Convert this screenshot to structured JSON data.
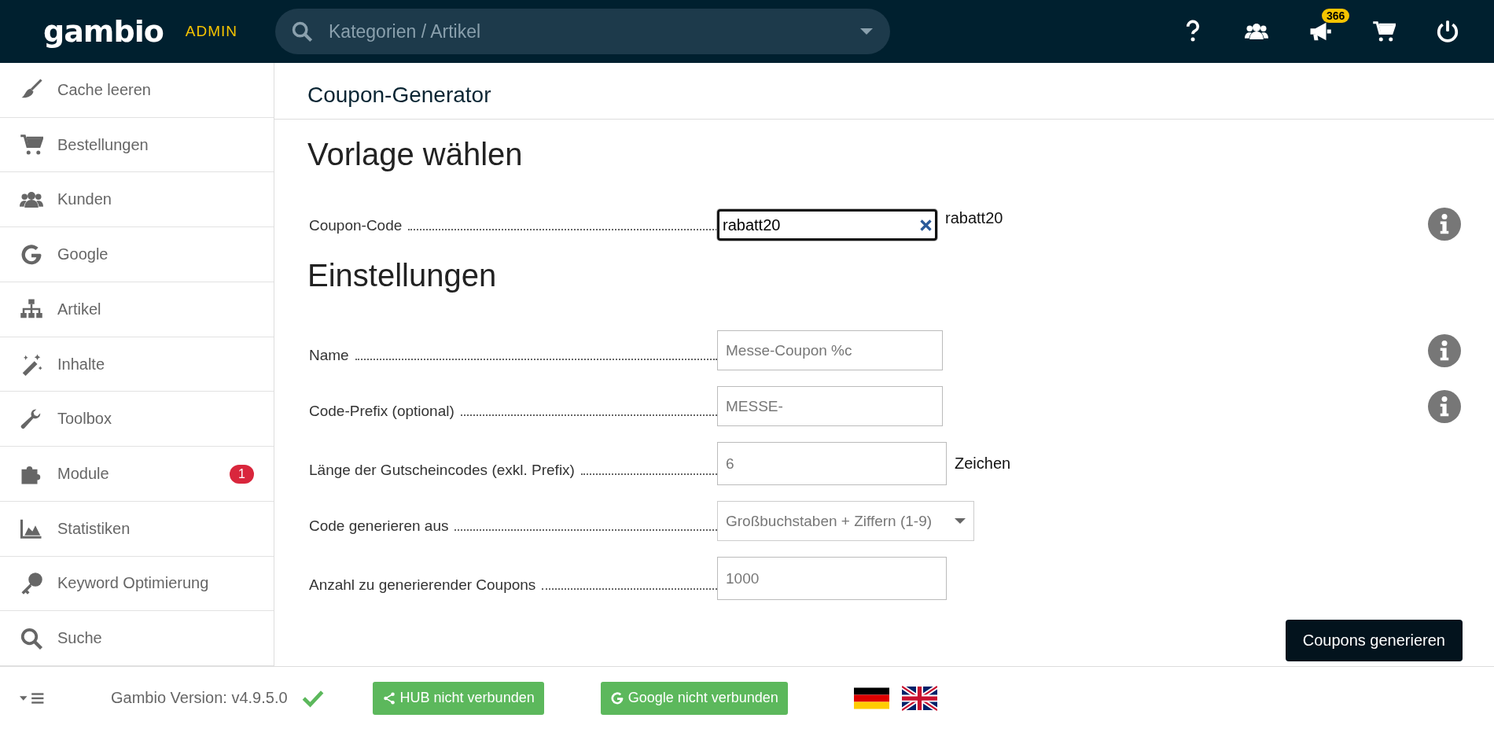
{
  "header": {
    "logo": "gambio",
    "logo_sub": "ADMIN",
    "search": {
      "placeholder": "Kategorien / Artikel"
    },
    "icons": [
      {
        "kind": "help"
      },
      {
        "kind": "users"
      },
      {
        "kind": "news",
        "badge": "366"
      },
      {
        "kind": "cart"
      },
      {
        "kind": "power"
      }
    ]
  },
  "sidebar": {
    "items": [
      {
        "kind": "broom",
        "label": "Cache leeren"
      },
      {
        "kind": "cart",
        "label": "Bestellungen"
      },
      {
        "kind": "users",
        "label": "Kunden"
      },
      {
        "kind": "google",
        "label": "Google"
      },
      {
        "kind": "sitemap",
        "label": "Artikel"
      },
      {
        "kind": "magic",
        "label": "Inhalte"
      },
      {
        "kind": "wrench",
        "label": "Toolbox"
      },
      {
        "kind": "puzzle",
        "label": "Module",
        "badge": "1"
      },
      {
        "kind": "chart",
        "label": "Statistiken"
      },
      {
        "kind": "key",
        "label": "Keyword Optimierung"
      },
      {
        "kind": "search",
        "label": "Suche"
      }
    ]
  },
  "page": {
    "title": "Coupon-Generator",
    "sections": [
      {
        "heading": "Vorlage wählen",
        "rows": [
          {
            "kind": "combo",
            "label": "Coupon-Code",
            "value": "rabatt20",
            "suffix": "rabatt20",
            "info": true
          }
        ]
      },
      {
        "heading": "Einstellungen",
        "rows": [
          {
            "kind": "input",
            "label": "Name",
            "placeholder": "Messe-Coupon %c",
            "info": true
          },
          {
            "kind": "input",
            "label": "Code-Prefix (optional)",
            "placeholder": "MESSE-",
            "info": true
          },
          {
            "kind": "input",
            "label": "Länge der Gutscheincodes (exkl. Prefix)",
            "placeholder": "6",
            "suffix": "Zeichen",
            "info": false
          },
          {
            "kind": "select",
            "label": "Code generieren aus",
            "value": "Großbuchstaben + Ziffern (1-9)",
            "info": false
          },
          {
            "kind": "input",
            "label": "Anzahl zu generierender Coupons",
            "placeholder": "1000",
            "info": false
          }
        ]
      }
    ],
    "submit": "Coupons generieren"
  },
  "footer": {
    "version": "Gambio Version: v4.9.5.0",
    "buttons": [
      {
        "kind": "hub",
        "label": "HUB nicht verbunden"
      },
      {
        "kind": "google",
        "label": "Google nicht verbunden"
      }
    ],
    "languages": [
      {
        "kind": "de"
      },
      {
        "kind": "en"
      }
    ]
  }
}
